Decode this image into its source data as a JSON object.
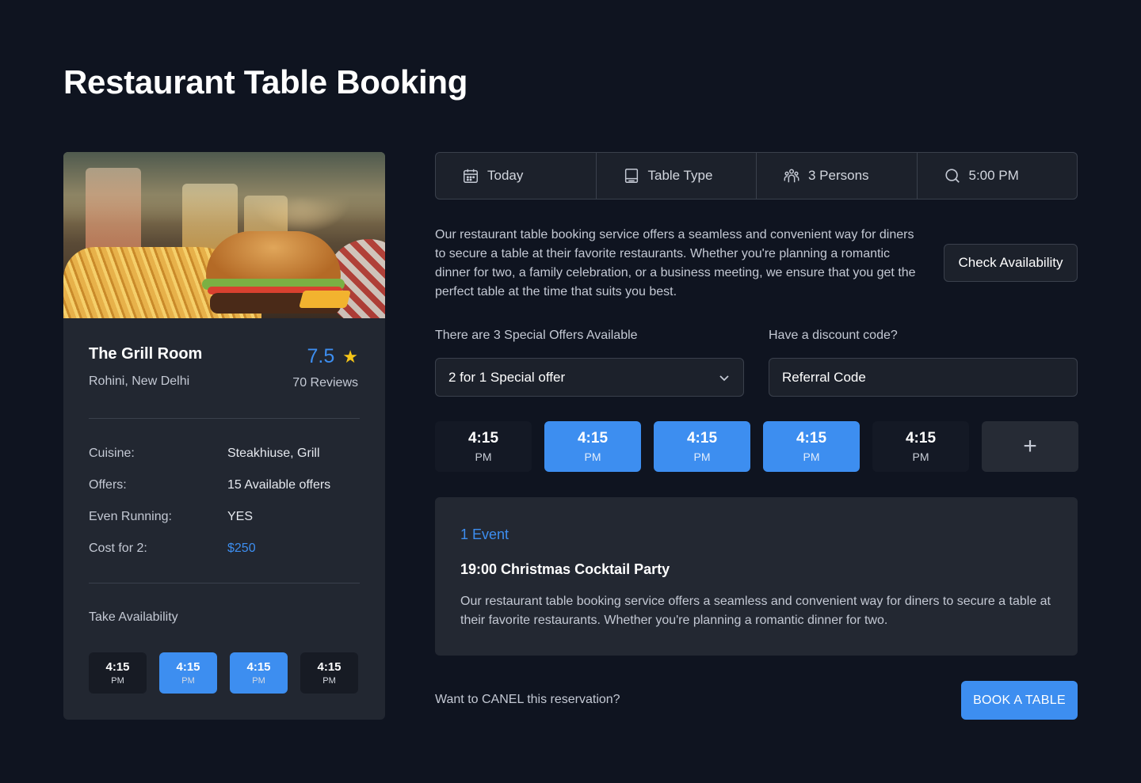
{
  "page": {
    "title": "Restaurant Table Booking"
  },
  "colors": {
    "background": "#0f1420",
    "card": "#222731",
    "accent": "#3d8ef0",
    "star": "#f5c518"
  },
  "restaurant": {
    "name": "The Grill Room",
    "location": "Rohini, New Delhi",
    "rating": "7.5",
    "reviews": "70 Reviews",
    "details": [
      {
        "label": "Cuisine:",
        "value": "Steakhiuse, Grill"
      },
      {
        "label": "Offers:",
        "value": "15 Available offers"
      },
      {
        "label": "Even Running:",
        "value": "YES"
      },
      {
        "label": "Cost for 2:",
        "value": "$250"
      }
    ],
    "availability_label": "Take Availability",
    "mini_slots": [
      {
        "time": "4:15",
        "period": "PM",
        "selected": false
      },
      {
        "time": "4:15",
        "period": "PM",
        "selected": true
      },
      {
        "time": "4:15",
        "period": "PM",
        "selected": true
      },
      {
        "time": "4:15",
        "period": "PM",
        "selected": false
      }
    ]
  },
  "filters": [
    {
      "icon": "calendar-icon",
      "label": "Today"
    },
    {
      "icon": "table-icon",
      "label": "Table Type"
    },
    {
      "icon": "persons-icon",
      "label": "3 Persons"
    },
    {
      "icon": "search-icon",
      "label": "5:00 PM"
    }
  ],
  "description": "Our restaurant table booking service offers a seamless and convenient way for diners to secure a table at their favorite restaurants. Whether you're planning a romantic dinner for two, a family celebration, or a business meeting, we ensure that you get the perfect table at the time that suits you best.",
  "check_button": "Check Availability",
  "offers": {
    "label": "There are 3 Special Offers Available",
    "selected": "2 for 1 Special offer"
  },
  "discount": {
    "label": "Have a discount code?",
    "placeholder": "Referral Code"
  },
  "slots": [
    {
      "time": "4:15",
      "period": "PM",
      "selected": false
    },
    {
      "time": "4:15",
      "period": "PM",
      "selected": true
    },
    {
      "time": "4:15",
      "period": "PM",
      "selected": true
    },
    {
      "time": "4:15",
      "period": "PM",
      "selected": true
    },
    {
      "time": "4:15",
      "period": "PM",
      "selected": false
    }
  ],
  "event": {
    "count": "1 Event",
    "title": "19:00 Christmas Cocktail Party",
    "description": "Our restaurant table booking service offers a seamless and convenient way for diners to secure a table at their favorite restaurants. Whether you're planning a romantic dinner for two."
  },
  "cancel_text": "Want to CANEL this reservation?",
  "book_button": "BOOK A TABLE"
}
